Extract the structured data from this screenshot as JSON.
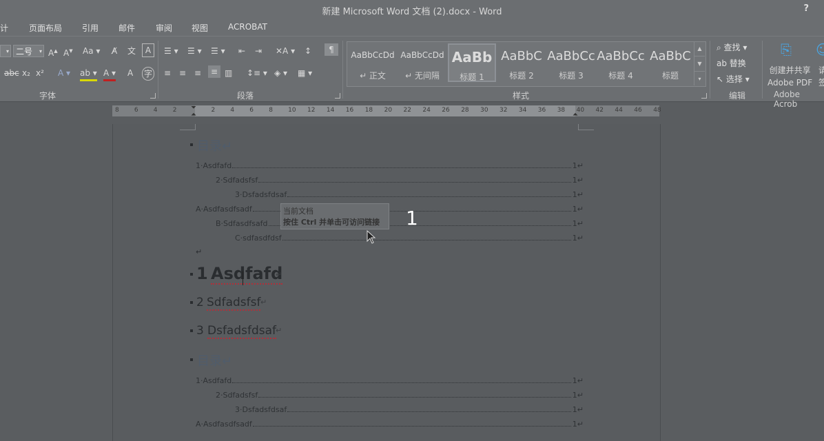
{
  "window": {
    "title": "新建 Microsoft Word 文档 (2).docx - Word",
    "help": "?"
  },
  "tabs": [
    "计",
    "页面布局",
    "引用",
    "邮件",
    "审阅",
    "视图",
    "ACROBAT"
  ],
  "font_group": {
    "size": "二号",
    "label": "字体",
    "font_grow": "A",
    "font_shrink": "A",
    "change_case": "Aa"
  },
  "paragraph_group": {
    "label": "段落"
  },
  "styles_group": {
    "label": "样式",
    "items": [
      {
        "sample": "AaBbCcDd",
        "name": "↵ 正文"
      },
      {
        "sample": "AaBbCcDd",
        "name": "↵ 无间隔"
      },
      {
        "sample": "AaBb",
        "name": "标题 1"
      },
      {
        "sample": "AaBbC",
        "name": "标题 2"
      },
      {
        "sample": "AaBbCc",
        "name": "标题 3"
      },
      {
        "sample": "AaBbCc",
        "name": "标题 4"
      },
      {
        "sample": "AaBbC",
        "name": "标题"
      }
    ]
  },
  "editing_group": {
    "find": "查找",
    "replace": "替换",
    "select": "选择",
    "label": "编辑"
  },
  "adobe_group": {
    "line1": "创建并共享",
    "line2": "Adobe PDF",
    "line3": "请",
    "line4": "签",
    "label": "Adobe Acrob"
  },
  "ruler": {
    "numbers": [
      "8",
      "6",
      "4",
      "2",
      "",
      "2",
      "4",
      "6",
      "8",
      "10",
      "12",
      "14",
      "16",
      "18",
      "20",
      "22",
      "24",
      "26",
      "28",
      "30",
      "32",
      "34",
      "36",
      "38",
      "40",
      "42",
      "44",
      "46",
      "48"
    ]
  },
  "document": {
    "toc_title": "目录↵",
    "toc_entries": [
      {
        "text": "1·Asdfafd",
        "page": "1↵"
      },
      {
        "text": "2·Sdfadsfsf",
        "page": "1↵"
      },
      {
        "text": "3·Dsfadsfdsaf",
        "page": "1↵"
      },
      {
        "text": "A·Asdfasdfsadf",
        "page": "1↵"
      },
      {
        "text": "B·Sdfasdfsafd",
        "page": "1↵"
      },
      {
        "text": "C·sdfasdfdsf",
        "page": "1↵"
      }
    ],
    "empty_para": "↵",
    "heading1_num": "1",
    "heading1_text": "Asdfafd",
    "heading2_num": "2",
    "heading2_text": "Sdfadsfsf",
    "heading3_num": "3",
    "heading3_text": "Dsfadsfdsaf",
    "toc2_title": "目录↵",
    "toc2_entries": [
      {
        "text": "1·Asdfafd",
        "page": "1↵"
      },
      {
        "text": "2·Sdfadsfsf",
        "page": "1↵"
      },
      {
        "text": "3·Dsfadsfdsaf",
        "page": "1↵"
      },
      {
        "text": "A·Asdfasdfsadf",
        "page": "1↵"
      }
    ]
  },
  "tooltip": {
    "line1": "当前文档",
    "line2": "按住 Ctrl 并单击可访问链接"
  },
  "overlay_number": "1"
}
